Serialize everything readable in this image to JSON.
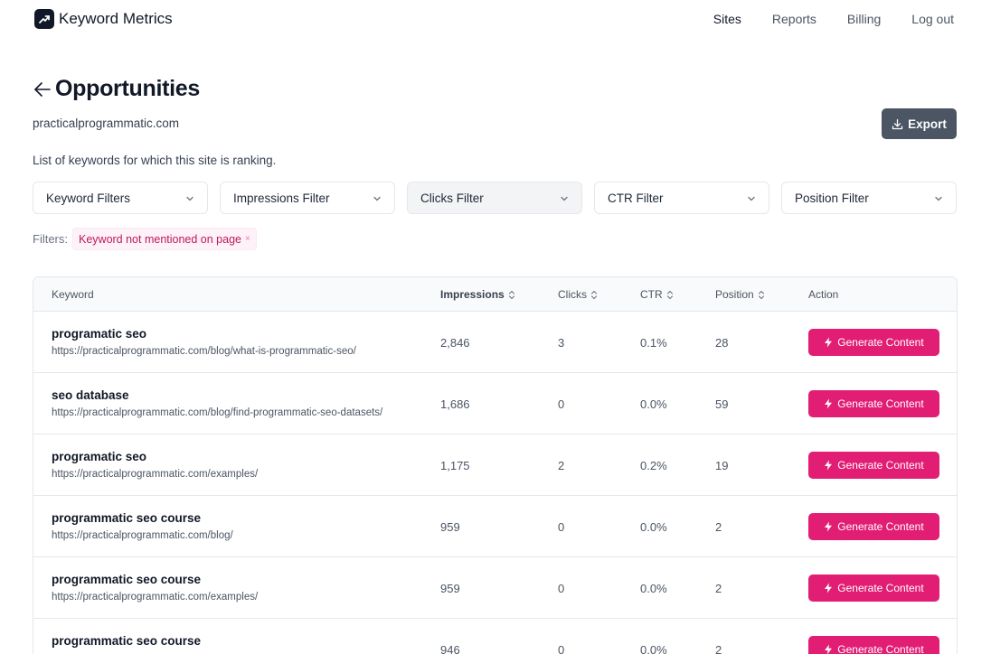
{
  "app": {
    "name": "Keyword Metrics"
  },
  "nav": {
    "items": [
      {
        "label": "Sites",
        "active": true
      },
      {
        "label": "Reports",
        "active": false
      },
      {
        "label": "Billing",
        "active": false
      },
      {
        "label": "Log out",
        "active": false
      }
    ]
  },
  "page": {
    "title": "Opportunities",
    "site": "practicalprogrammatic.com",
    "description": "List of keywords for which this site is ranking.",
    "export_label": "Export"
  },
  "filters": {
    "dropdowns": [
      {
        "label": "Keyword Filters"
      },
      {
        "label": "Impressions Filter"
      },
      {
        "label": "Clicks Filter"
      },
      {
        "label": "CTR Filter"
      },
      {
        "label": "Position Filter"
      }
    ],
    "active_label": "Filters:",
    "active": [
      {
        "label": "Keyword not mentioned on page",
        "remove": "×"
      }
    ]
  },
  "table": {
    "columns": {
      "keyword": "Keyword",
      "impressions": "Impressions",
      "clicks": "Clicks",
      "ctr": "CTR",
      "position": "Position",
      "action": "Action"
    },
    "action_label": "Generate Content",
    "rows": [
      {
        "keyword": "programatic seo",
        "url": "https://practicalprogrammatic.com/blog/what-is-programmatic-seo/",
        "impressions": "2,846",
        "clicks": "3",
        "ctr": "0.1%",
        "position": "28"
      },
      {
        "keyword": "seo database",
        "url": "https://practicalprogrammatic.com/blog/find-programmatic-seo-datasets/",
        "impressions": "1,686",
        "clicks": "0",
        "ctr": "0.0%",
        "position": "59"
      },
      {
        "keyword": "programatic seo",
        "url": "https://practicalprogrammatic.com/examples/",
        "impressions": "1,175",
        "clicks": "2",
        "ctr": "0.2%",
        "position": "19"
      },
      {
        "keyword": "programmatic seo course",
        "url": "https://practicalprogrammatic.com/blog/",
        "impressions": "959",
        "clicks": "0",
        "ctr": "0.0%",
        "position": "2"
      },
      {
        "keyword": "programmatic seo course",
        "url": "https://practicalprogrammatic.com/examples/",
        "impressions": "959",
        "clicks": "0",
        "ctr": "0.0%",
        "position": "2"
      },
      {
        "keyword": "programmatic seo course",
        "url": "",
        "impressions": "946",
        "clicks": "0",
        "ctr": "0.0%",
        "position": "2"
      }
    ]
  },
  "colors": {
    "brand_dark": "#111827",
    "accent_pink": "#e11d74",
    "export_gray": "#4b5563"
  }
}
